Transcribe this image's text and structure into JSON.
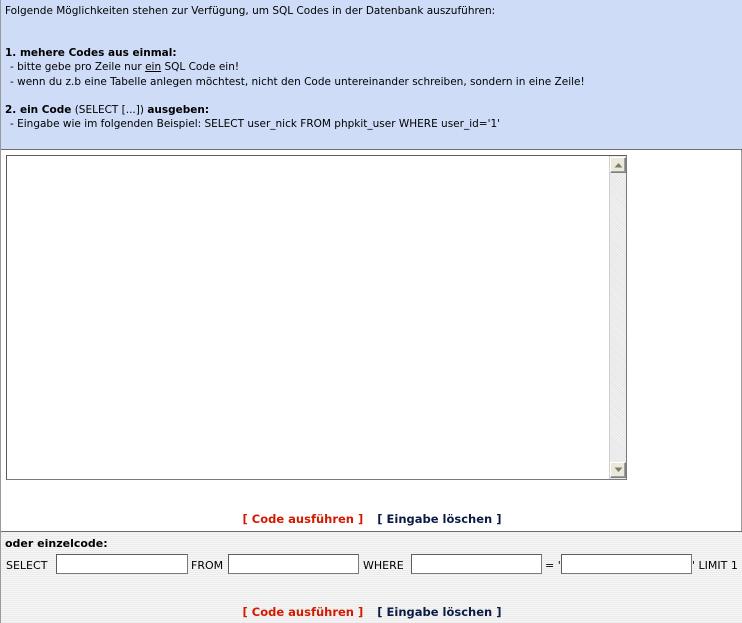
{
  "info": {
    "intro": "Folgende Möglichkeiten stehen zur Verfügung, um SQL Codes in der Datenbank auszuführen:",
    "section1_title": "1. mehere Codes aus einmal:",
    "section1_line1_pre": "- bitte gebe pro Zeile nur ",
    "section1_line1_underlined": "ein",
    "section1_line1_post": " SQL Code ein!",
    "section1_line2": "- wenn du z.b eine Tabelle anlegen möchtest, nicht den Code untereinander schreiben, sondern in eine Zeile!",
    "section2_title_bold1": "2. ein Code",
    "section2_title_normal": " (SELECT [...]) ",
    "section2_title_bold2": "ausgeben:",
    "section2_line1": "- Eingabe wie im folgenden Beispiel: SELECT user_nick FROM phpkit_user WHERE user_id='1'"
  },
  "editor": {
    "value": ""
  },
  "actions": {
    "run_label": "[ Code ausführen ]",
    "clear_label": "[ Eingabe löschen ]"
  },
  "single": {
    "title": "oder einzelcode:",
    "select_label": "SELECT",
    "from_label": "FROM",
    "where_label": "WHERE",
    "equals_label": "= '",
    "limit_label": "' LIMIT 1",
    "select_value": "",
    "from_value": "",
    "where_value": "",
    "equals_value": ""
  },
  "colors": {
    "info_background": "#cfdcf7",
    "run_color": "#d21a00",
    "clear_color": "#0a1b44"
  }
}
